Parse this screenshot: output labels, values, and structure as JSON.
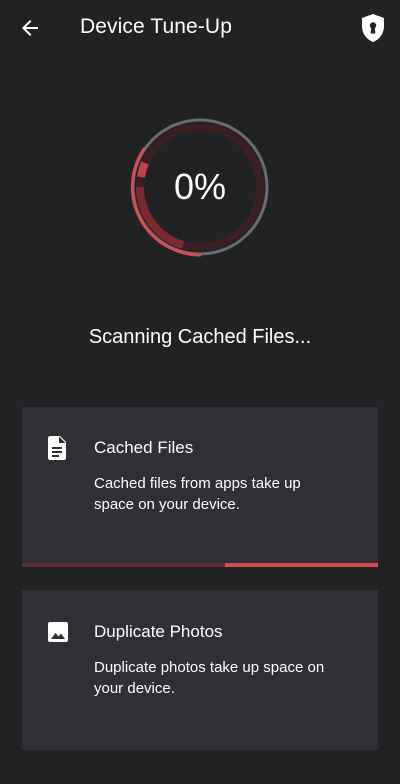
{
  "header": {
    "title": "Device Tune-Up",
    "back_icon": "arrow-left-icon",
    "shield_icon": "shield-keyhole-icon"
  },
  "scan": {
    "progress_text": "0%",
    "progress_fraction": 0.0,
    "status": "Scanning Cached Files..."
  },
  "cards": [
    {
      "icon": "document-icon",
      "title": "Cached Files",
      "description": "Cached files from apps take up space on your device.",
      "progress_fraction": 0.43
    },
    {
      "icon": "image-icon",
      "title": "Duplicate Photos",
      "description": "Duplicate photos take up space on your device."
    }
  ],
  "colors": {
    "background": "#212224",
    "card": "#2f3033",
    "accent": "#d94b52",
    "ring_track": "#6b6c70"
  }
}
